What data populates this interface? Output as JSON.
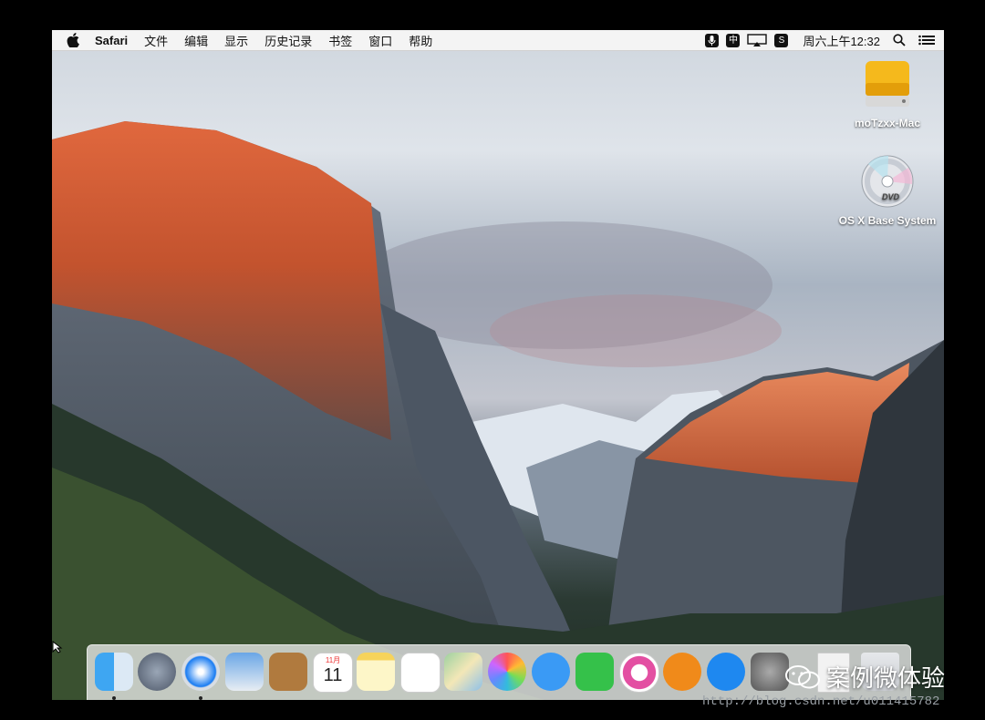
{
  "menubar": {
    "app_name": "Safari",
    "items": [
      "文件",
      "编辑",
      "显示",
      "历史记录",
      "书签",
      "窗口",
      "帮助"
    ],
    "status": {
      "input_method_char": "中",
      "sogou_char": "S",
      "clock": "周六上午12:32"
    }
  },
  "desktop": {
    "icons": [
      {
        "label": "moTzxx-Mac",
        "icon": "hard-drive-icon"
      },
      {
        "label": "OS X Base System",
        "icon": "dvd-disc-icon",
        "disc_text": "DVD"
      }
    ]
  },
  "dock": {
    "apps": [
      "finder-icon",
      "launchpad-icon",
      "safari-icon",
      "preview-icon",
      "contacts-icon",
      "calendar-icon",
      "notes-icon",
      "reminders-icon",
      "maps-icon",
      "photos-icon",
      "messages-icon",
      "facetime-icon",
      "itunes-icon",
      "ibooks-icon",
      "app-store-icon",
      "system-preferences-icon",
      "documents-icon",
      "trash-icon"
    ],
    "calendar": {
      "month": "11月",
      "day": "11"
    }
  },
  "watermark": {
    "text": "案例微体验",
    "url": "http://blog.csdn.net/u011415782"
  },
  "colors": {
    "menubar": "#f4f4f4",
    "dock": "#ebebeb",
    "accent": "#1a7cf2"
  }
}
